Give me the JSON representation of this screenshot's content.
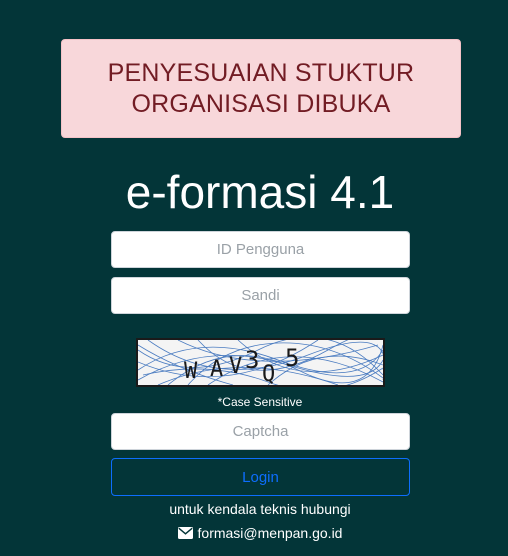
{
  "alert": {
    "line1": "PENYESUAIAN STUKTUR",
    "line2": "ORGANISASI DIBUKA",
    "background": "#f8d7da",
    "text_color": "#721c24"
  },
  "app_title": "e-formasi 4.1",
  "form": {
    "user_placeholder": "ID Pengguna",
    "password_placeholder": "Sandi",
    "captcha_image": {
      "characters": [
        "W",
        "A",
        "V",
        "3",
        "Q",
        "5"
      ]
    },
    "case_note": "*Case Sensitive",
    "captcha_placeholder": "Captcha",
    "login_label": "Login"
  },
  "footer": {
    "help_text": "untuk kendala teknis hubungi",
    "email": "formasi@menpan.go.id",
    "email_icon": "envelope-icon"
  },
  "colors": {
    "page_background": "#033538",
    "login_accent": "#0d6efd"
  }
}
